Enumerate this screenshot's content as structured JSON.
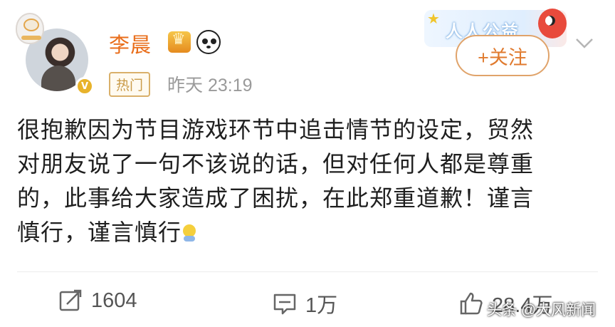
{
  "post": {
    "author": "李晨",
    "tag": "热门",
    "time": "昨天 23:19",
    "follow_label": "+关注",
    "promo_text": "人人公益",
    "lines": [
      "很抱歉因为节目游戏环节中追击情节的设定，贸然",
      "对朋友说了一句不该说的话，但对任何人都是尊重",
      "的，此事给大家造成了困扰，在此郑重道歉！谨言",
      "慎行，谨言慎行"
    ],
    "verified_badge": "V"
  },
  "actions": {
    "repost_count": "1604",
    "comment_count": "1万",
    "like_count": "28.4万"
  },
  "watermark": "头条 @大风新闻",
  "colors": {
    "username": "#e96e1b",
    "follow_border": "#e0a36a",
    "text": "#1f1f1f",
    "muted": "#9a9a9a"
  },
  "icons": [
    "avatar-pendant-icon",
    "crown-icon",
    "panda-icon",
    "star-icon",
    "bird-icon",
    "chevron-down-icon",
    "emoji-icon",
    "repost-icon",
    "comment-icon",
    "like-icon"
  ]
}
